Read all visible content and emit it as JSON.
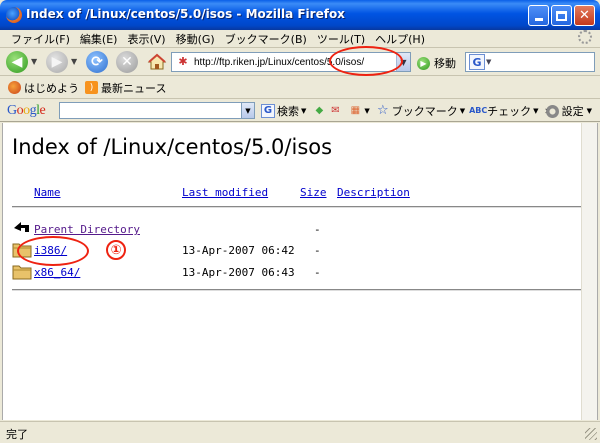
{
  "window": {
    "title": "Index of /Linux/centos/5.0/isos - Mozilla Firefox",
    "accent": "#0054e3"
  },
  "menu": {
    "items": [
      "ファイル(F)",
      "編集(E)",
      "表示(V)",
      "移動(G)",
      "ブックマーク(B)",
      "ツール(T)",
      "ヘルプ(H)"
    ]
  },
  "navigation": {
    "url": "http://ftp.riken.jp/Linux/centos/5.0/isos/",
    "go_label": "移動",
    "icons": [
      "back-arrow-icon",
      "forward-arrow-icon",
      "reload-icon",
      "stop-icon",
      "home-icon"
    ]
  },
  "bookmarks": {
    "items": [
      {
        "label": "はじめよう",
        "icon": "firefox-icon"
      },
      {
        "label": "最新ニュース",
        "icon": "rss-feed-icon"
      }
    ]
  },
  "google_toolbar": {
    "logo": "Google",
    "search_label": "検索",
    "bookmarks_label": "ブックマーク",
    "check_label": "チェック",
    "more_label": "»",
    "settings_label": "設定"
  },
  "page": {
    "title": "Index of /Linux/centos/5.0/isos",
    "headers": {
      "name": "Name",
      "modified": "Last modified",
      "size": "Size",
      "description": "Description"
    },
    "rows": [
      {
        "name": "Parent Directory",
        "modified": "",
        "size": "-",
        "icon": "back-arrow-icon"
      },
      {
        "name": "i386/",
        "modified": "13-Apr-2007 06:42",
        "size": "-",
        "icon": "folder-icon"
      },
      {
        "name": "x86_64/",
        "modified": "13-Apr-2007 06:43",
        "size": "-",
        "icon": "folder-icon"
      }
    ],
    "annotation_marker": "①",
    "annotation_color": "#e21111"
  },
  "status": {
    "text": "完了"
  }
}
